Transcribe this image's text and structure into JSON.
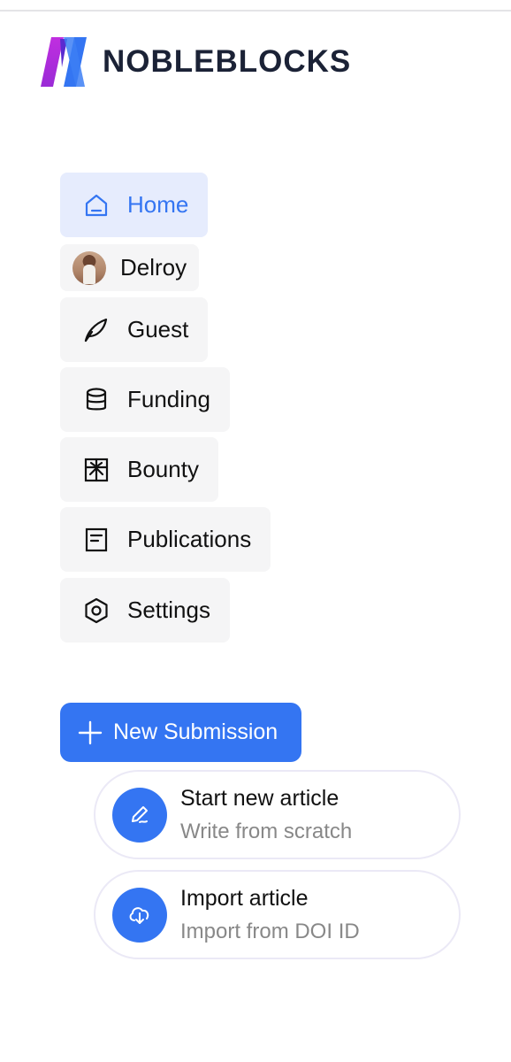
{
  "brand": {
    "name": "NOBLEBLOCKS",
    "logo_icon": "nobleblocks-logo-icon",
    "colors": [
      "#b42ed8",
      "#3475f2"
    ]
  },
  "nav": {
    "active_color": "#3475f2",
    "items": [
      {
        "label": "Home",
        "icon": "home-icon",
        "active": true
      },
      {
        "label": "Delroy",
        "icon": "avatar",
        "active": false
      },
      {
        "label": "Guest",
        "icon": "feather-icon",
        "active": false
      },
      {
        "label": "Funding",
        "icon": "database-icon",
        "active": false
      },
      {
        "label": "Bounty",
        "icon": "bounty-icon",
        "active": false
      },
      {
        "label": "Publications",
        "icon": "document-icon",
        "active": false
      },
      {
        "label": "Settings",
        "icon": "hexagon-settings-icon",
        "active": false
      }
    ]
  },
  "new_submission": {
    "label": "New Submission",
    "icon": "plus-icon",
    "options": [
      {
        "title": "Start new article",
        "subtitle": "Write from scratch",
        "icon": "pen-icon"
      },
      {
        "title": "Import article",
        "subtitle": "Import from DOI ID",
        "icon": "cloud-download-icon"
      }
    ]
  }
}
